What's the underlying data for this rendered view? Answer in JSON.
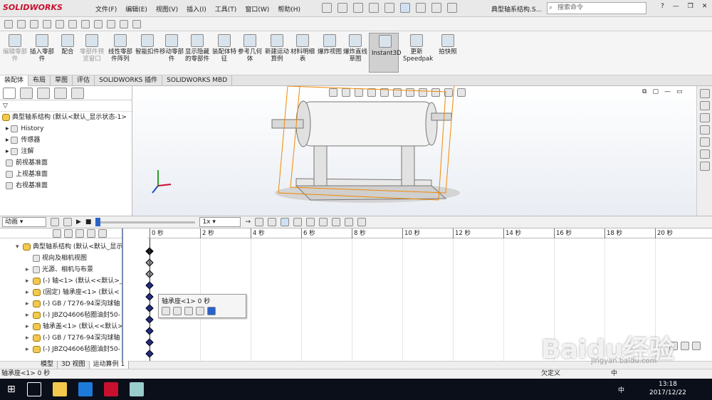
{
  "app": {
    "logo": "SOLIDWORKS",
    "window_title": "典型轴系结构.S...",
    "search_placeholder": "搜索命令",
    "help": "?"
  },
  "menus": [
    "文件(F)",
    "编辑(E)",
    "视图(V)",
    "插入(I)",
    "工具(T)",
    "窗口(W)",
    "帮助(H)"
  ],
  "ribbon": [
    {
      "label": "编辑零部件",
      "disabled": true
    },
    {
      "label": "插入零部件",
      "disabled": false
    },
    {
      "label": "配合",
      "disabled": false
    },
    {
      "label": "零部件预览窗口",
      "disabled": true
    },
    {
      "label": "线性零部件阵列",
      "disabled": false
    },
    {
      "label": "智能扣件",
      "disabled": false
    },
    {
      "label": "移动零部件",
      "disabled": false
    },
    {
      "label": "显示隐藏的零部件",
      "disabled": false
    },
    {
      "label": "装配体特征",
      "disabled": false
    },
    {
      "label": "参考几何体",
      "disabled": false
    },
    {
      "label": "新建运动算例",
      "disabled": false
    },
    {
      "label": "材料明细表",
      "disabled": false
    },
    {
      "label": "爆炸视图",
      "disabled": false
    },
    {
      "label": "爆炸直线草图",
      "disabled": false
    },
    {
      "label": "Instant3D",
      "disabled": false,
      "selected": true
    },
    {
      "label": "更新Speedpak",
      "disabled": false
    },
    {
      "label": "拍快照",
      "disabled": false
    }
  ],
  "command_tabs": [
    "装配体",
    "布局",
    "草图",
    "评估",
    "SOLIDWORKS 插件",
    "SOLIDWORKS MBD"
  ],
  "feature_tree": {
    "root": "典型轴系结构 (默认<默认_显示状态-1>",
    "items": [
      "History",
      "传感器",
      "注解",
      "前视基准面",
      "上视基准面",
      "右视基准面"
    ]
  },
  "motion": {
    "study_type": "动画",
    "speed": "1x"
  },
  "timeline": {
    "ticks": [
      "0 秒",
      "2 秒",
      "4 秒",
      "6 秒",
      "8 秒",
      "10 秒",
      "12 秒",
      "14 秒",
      "16 秒",
      "18 秒",
      "20 秒"
    ],
    "rows": [
      {
        "label": "典型轴系结构 (默认<默认_显示",
        "part": true
      },
      {
        "label": "视向及相机视图",
        "part": false
      },
      {
        "label": "光源、相机与布景",
        "part": false
      },
      {
        "label": "(-) 轴<1> (默认<<默认>_",
        "part": true
      },
      {
        "label": "(固定) 轴承座<1> (默认<",
        "part": true
      },
      {
        "label": "(-) GB / T276-94深沟球轴",
        "part": true
      },
      {
        "label": "(-) JBZQ4606毡圈油封50-",
        "part": true
      },
      {
        "label": "轴承盖<1> (默认<<默认>",
        "part": true
      },
      {
        "label": "(-) GB / T276-94深沟球轴",
        "part": true
      },
      {
        "label": "(-) JBZQ4606毡圈油封50-",
        "part": true
      }
    ],
    "tooltip_title": "轴承座<1> 0 秒"
  },
  "bottom_tabs": [
    "模型",
    "3D 视图",
    "运动算例 1"
  ],
  "status": {
    "left": "轴承座<1> 0 秒",
    "right": "欠定义",
    "ime": "中"
  },
  "taskbar": {
    "time": "13:18",
    "date": "2017/12/22",
    "ime": "中"
  },
  "watermark": {
    "main": "Baidu经验",
    "sub": "jingyan.baidu.com"
  }
}
